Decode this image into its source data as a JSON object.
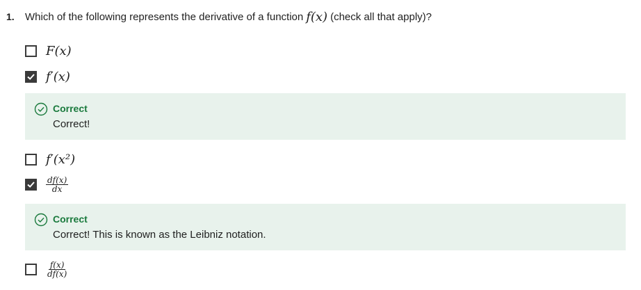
{
  "question": {
    "number": "1.",
    "text_before": "Which of the following represents the derivative of a function",
    "math": "f(x)",
    "text_after": "(check all that apply)?"
  },
  "options": [
    {
      "label": "F(x)",
      "checked": false
    },
    {
      "label": "f′(x)",
      "checked": true
    },
    {
      "label": "f′(x²)",
      "checked": false
    },
    {
      "numerator": "df(x)",
      "denominator": "dx",
      "checked": true
    },
    {
      "numerator": "f(x)",
      "denominator": "df(x)",
      "checked": false
    }
  ],
  "feedback": [
    {
      "title": "Correct",
      "text": "Correct!"
    },
    {
      "title": "Correct",
      "text": "Correct! This is known as the Leibniz notation."
    }
  ],
  "colors": {
    "success": "#1a7a3d",
    "feedback_bg": "#e8f2ec",
    "checkbox": "#3a3a3a"
  }
}
